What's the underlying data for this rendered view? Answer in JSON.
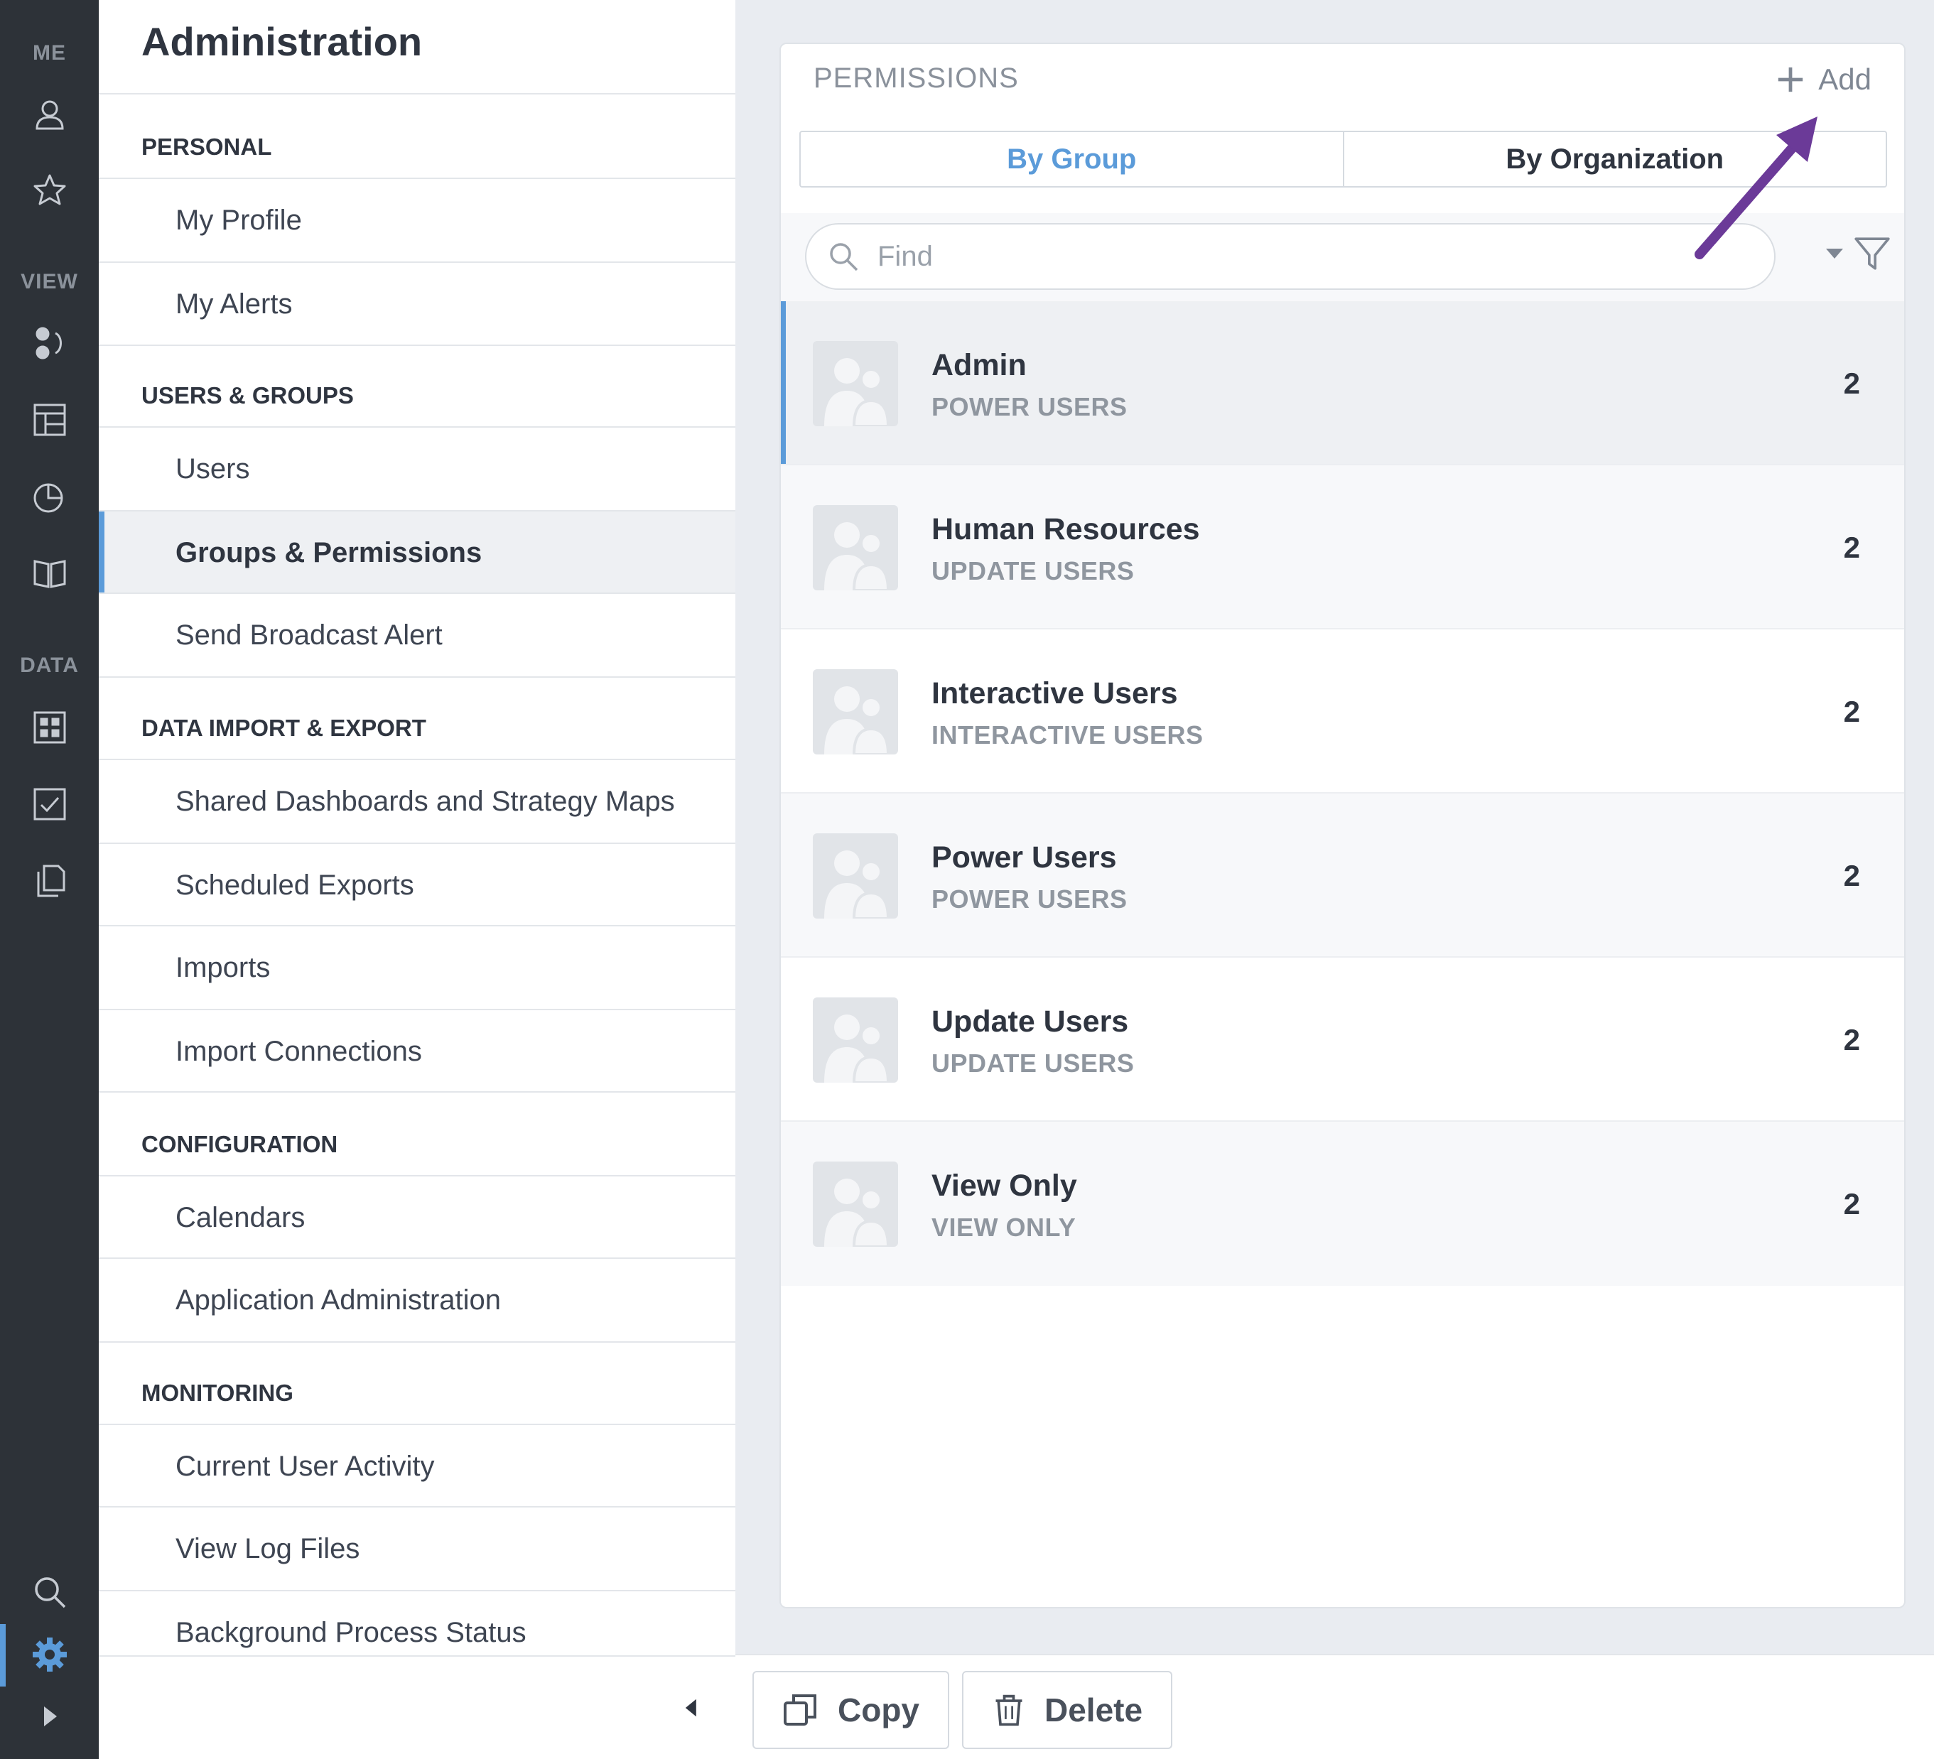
{
  "rail": {
    "sections": {
      "me": "ME",
      "view": "VIEW",
      "data": "DATA"
    },
    "icons": {
      "me": [
        "user-icon",
        "star-icon"
      ],
      "view": [
        "dashboard-flow-icon",
        "layout-icon",
        "pie-chart-icon",
        "book-icon"
      ],
      "data": [
        "scorecard-icon",
        "checkbox-icon",
        "documents-icon"
      ],
      "bottom": [
        "search-icon",
        "gear-icon",
        "expand-arrow-icon"
      ]
    },
    "active_icon": "gear-icon",
    "accent_color": "#5b9bd9"
  },
  "menu": {
    "title": "Administration",
    "sections": [
      {
        "label": "PERSONAL",
        "items": [
          "My Profile",
          "My Alerts"
        ]
      },
      {
        "label": "USERS & GROUPS",
        "items": [
          "Users",
          "Groups & Permissions",
          "Send Broadcast Alert"
        ]
      },
      {
        "label": "DATA IMPORT & EXPORT",
        "items": [
          "Shared Dashboards and Strategy Maps",
          "Scheduled Exports",
          "Imports",
          "Import Connections"
        ]
      },
      {
        "label": "CONFIGURATION",
        "items": [
          "Calendars",
          "Application Administration"
        ]
      },
      {
        "label": "MONITORING",
        "items": [
          "Current User Activity",
          "View Log Files",
          "Background Process Status"
        ]
      }
    ],
    "active_item": "Groups & Permissions"
  },
  "panel": {
    "title": "PERMISSIONS",
    "add_label": "Add",
    "tabs": [
      "By Group",
      "By Organization"
    ],
    "active_tab": "By Group",
    "find_placeholder": "Find",
    "groups": [
      {
        "name": "Admin",
        "subtitle": "POWER USERS",
        "count": "2",
        "selected": true
      },
      {
        "name": "Human Resources",
        "subtitle": "UPDATE USERS",
        "count": "2"
      },
      {
        "name": "Interactive Users",
        "subtitle": "INTERACTIVE USERS",
        "count": "2"
      },
      {
        "name": "Power Users",
        "subtitle": "POWER USERS",
        "count": "2"
      },
      {
        "name": "Update Users",
        "subtitle": "UPDATE USERS",
        "count": "2"
      },
      {
        "name": "View Only",
        "subtitle": "VIEW ONLY",
        "count": "2"
      }
    ]
  },
  "actions": {
    "copy_label": "Copy",
    "delete_label": "Delete"
  },
  "annotation": {
    "arrow_color": "#6b3a98",
    "points_to": "add-button"
  }
}
